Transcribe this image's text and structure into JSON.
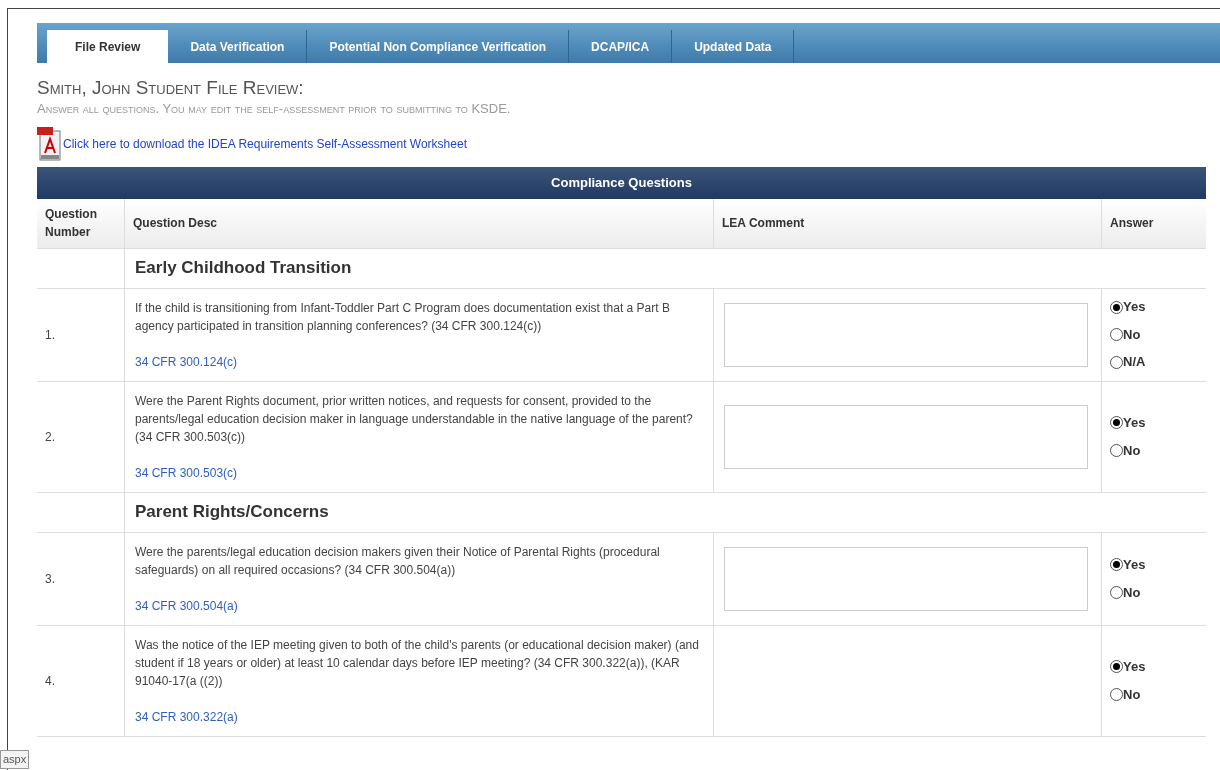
{
  "tabs": [
    {
      "label": "File Review",
      "selected": true
    },
    {
      "label": "Data Verification",
      "selected": false
    },
    {
      "label": "Potential Non Compliance Verification",
      "selected": false
    },
    {
      "label": "DCAP/ICA",
      "selected": false
    },
    {
      "label": "Updated Data",
      "selected": false
    }
  ],
  "heading": "Smith, John Student File Review:",
  "subheading": "Answer all questions. You may edit the self-assessment prior to submitting to KSDE.",
  "download_link": "Click here to download the IDEA Requirements Self-Assessment Worksheet",
  "table": {
    "title": "Compliance Questions",
    "columns": [
      "Question Number",
      "Question Desc",
      "LEA Comment",
      "Answer"
    ],
    "rows": [
      {
        "kind": "section",
        "title": "Early Childhood Transition"
      },
      {
        "kind": "question",
        "number": "1.",
        "text": "If the child is transitioning from Infant-Toddler Part C Program does documentation exist that a Part B agency participated in transition planning conferences? (34 CFR 300.124(c))",
        "link": "34 CFR 300.124(c)",
        "comment_field": true,
        "answers": [
          {
            "label": "Yes",
            "selected": true
          },
          {
            "label": "No",
            "selected": false
          },
          {
            "label": "N/A",
            "selected": false
          }
        ]
      },
      {
        "kind": "question",
        "number": "2.",
        "text": "Were the Parent Rights document, prior written notices, and requests for consent, provided to the parents/legal education decision maker in language understandable in the native language of the parent? (34 CFR 300.503(c))",
        "link": "34 CFR 300.503(c)",
        "comment_field": true,
        "answers": [
          {
            "label": "Yes",
            "selected": true
          },
          {
            "label": "No",
            "selected": false
          }
        ]
      },
      {
        "kind": "section",
        "title": "Parent Rights/Concerns"
      },
      {
        "kind": "question",
        "number": "3.",
        "text": "Were the parents/legal education decision makers given their Notice of Parental Rights (procedural safeguards) on all required occasions? (34 CFR 300.504(a))",
        "link": "34 CFR 300.504(a)",
        "comment_field": true,
        "answers": [
          {
            "label": "Yes",
            "selected": true
          },
          {
            "label": "No",
            "selected": false
          }
        ]
      },
      {
        "kind": "question",
        "number": "4.",
        "text": "Was the notice of the IEP meeting given to both of the child's parents (or educational decision maker) (and student if 18 years or older) at least 10 calendar days before IEP meeting? (34 CFR 300.322(a)), (KAR 91040-17(a ((2))",
        "link": "34 CFR 300.322(a)",
        "comment_field": false,
        "answers": [
          {
            "label": "Yes",
            "selected": true
          },
          {
            "label": "No",
            "selected": false
          }
        ]
      }
    ]
  },
  "status_tooltip": "aspx"
}
